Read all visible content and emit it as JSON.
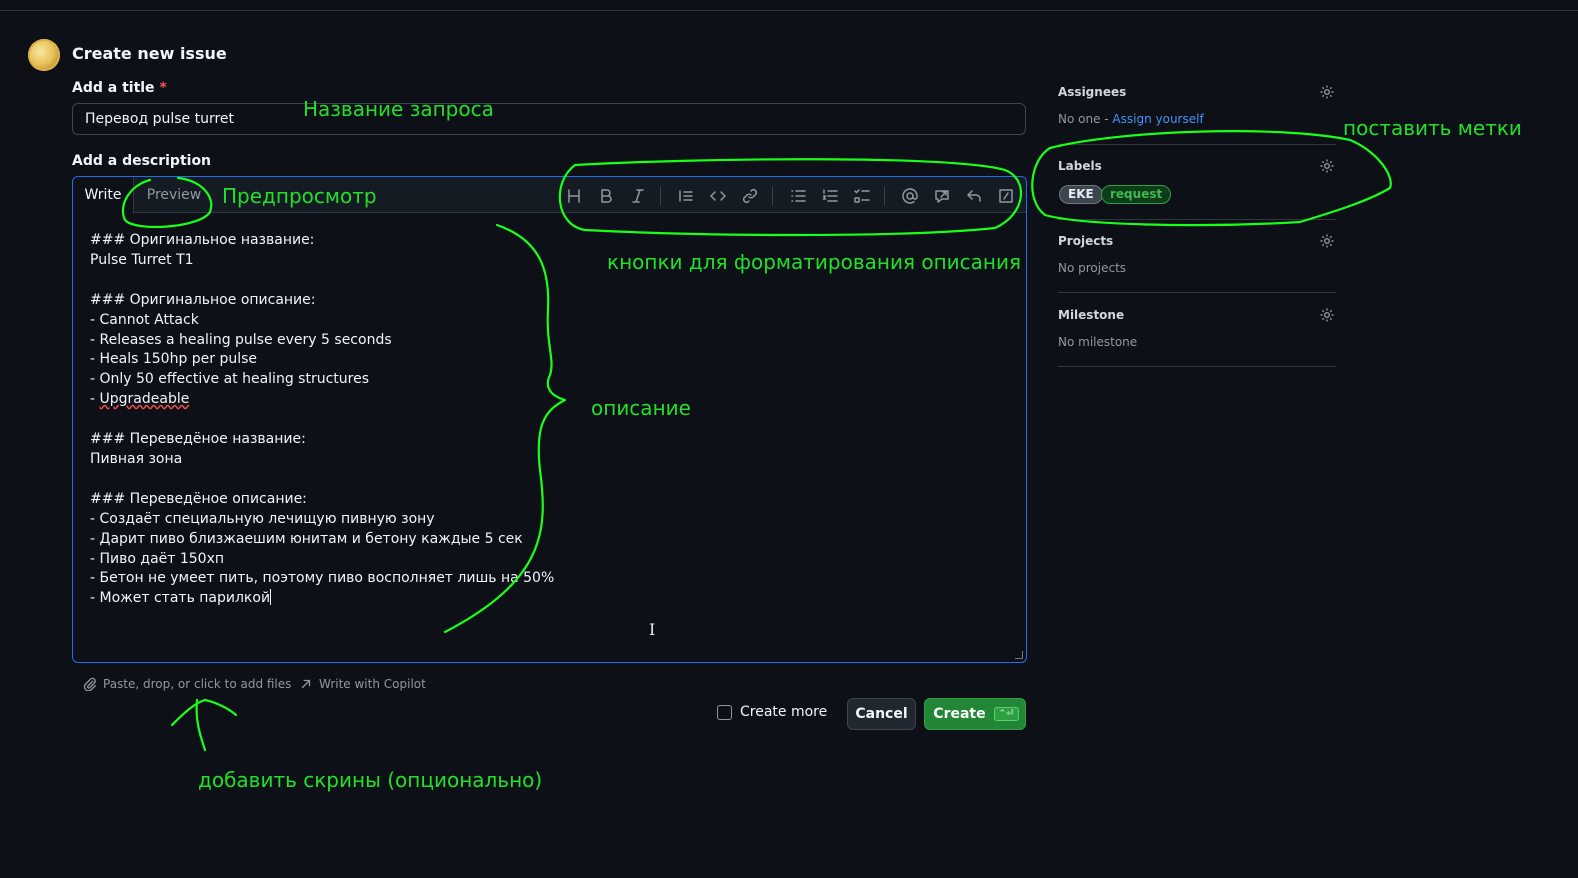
{
  "header": {
    "title": "Create new issue"
  },
  "title_field": {
    "label": "Add a title",
    "required_mark": "*",
    "value": "Перевод pulse turret"
  },
  "description": {
    "label": "Add a description",
    "tabs": {
      "write": "Write",
      "preview": "Preview"
    },
    "toolbar_icons": [
      "heading-icon",
      "bold-icon",
      "italic-icon",
      "quote-icon",
      "code-icon",
      "link-icon",
      "bulleted-list-icon",
      "numbered-list-icon",
      "task-list-icon",
      "mention-icon",
      "reference-icon",
      "saved-replies-icon",
      "slash-commands-icon"
    ],
    "lines": [
      "### Оригинальное название:",
      "Pulse Turret T1",
      "",
      "### Оригинальное описание:",
      "- Cannot Attack",
      "- Releases a healing pulse every 5 seconds",
      "- Heals 150hp per pulse",
      "- Only 50 effective at healing structures",
      "- ",
      "Upgradeable",
      "",
      "### Переведёное название:",
      "Пивная зона",
      "",
      "### Переведёное описание:",
      "- Создаёт специальную лечищую пивную зону",
      "- Дарит пиво близжаешим юнитам и бетону каждые 5 сек",
      "- Пиво даёт 150хп",
      "- Бетон не умеет пить, поэтому пиво восполняет лишь на 50%",
      "- Может стать парилкой"
    ],
    "attach_hint": "Paste, drop, or click to add files",
    "copilot": "Write with Copilot"
  },
  "actions": {
    "create_more": "Create more",
    "cancel": "Cancel",
    "create": "Create",
    "create_shortcut": "⌃⏎"
  },
  "sidebar": {
    "assignees": {
      "heading": "Assignees",
      "value_prefix": "No one - ",
      "link": "Assign yourself"
    },
    "labels": {
      "heading": "Labels",
      "items": [
        {
          "name": "EKE",
          "color": "#3d444d"
        },
        {
          "name": "request",
          "color": "#2ea043"
        }
      ]
    },
    "projects": {
      "heading": "Projects",
      "value": "No projects"
    },
    "milestone": {
      "heading": "Milestone",
      "value": "No milestone"
    }
  },
  "annotations": {
    "title": "Название запроса",
    "preview": "Предпросмотр",
    "toolbar": "кнопки для форматирования описания",
    "description": "описание",
    "labels": "поставить метки",
    "attach": "добавить скрины (опционально)",
    "color": "#22e02a"
  },
  "colors": {
    "background": "#0d1117",
    "accent": "#1f6feb",
    "primary_button": "#238636",
    "link": "#4493f8"
  }
}
